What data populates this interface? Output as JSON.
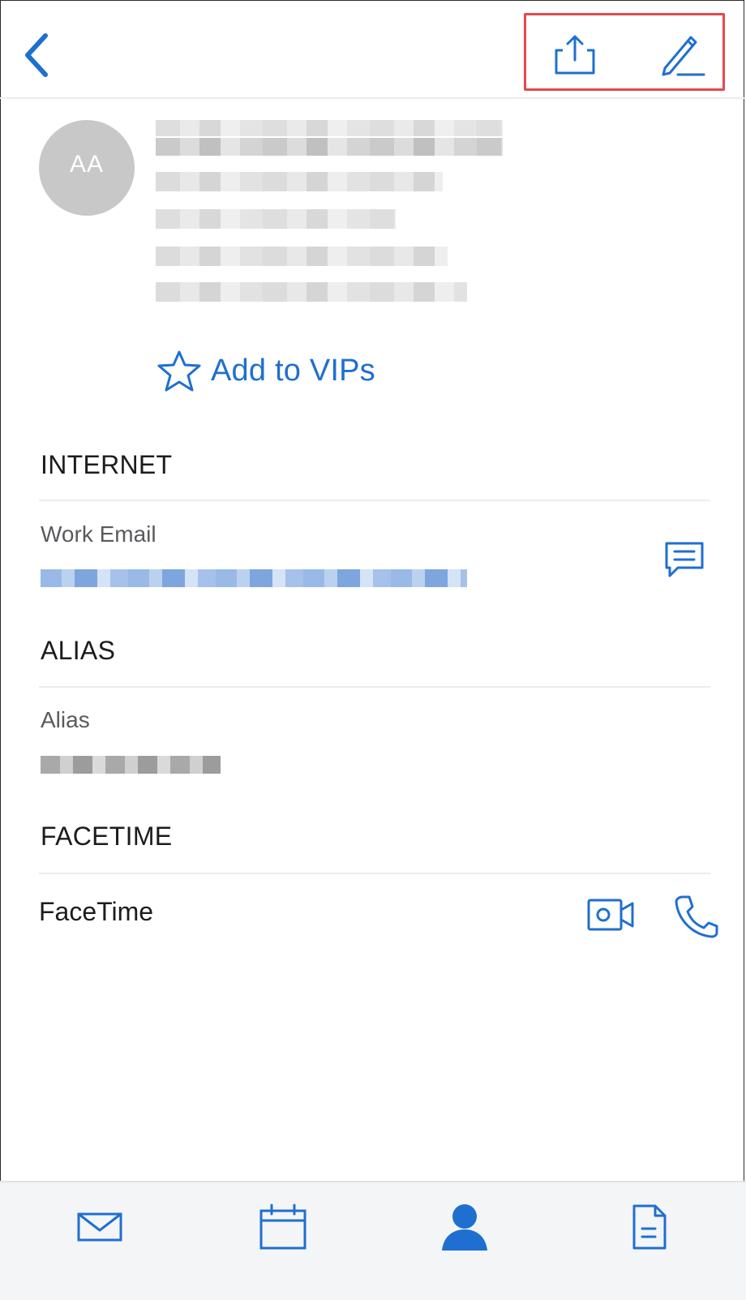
{
  "contact": {
    "initials": "AA"
  },
  "vip": {
    "label": "Add to VIPs"
  },
  "sections": {
    "internet_title": "INTERNET",
    "work_email_label": "Work Email",
    "alias_title": "ALIAS",
    "alias_label": "Alias",
    "facetime_title": "FACETIME",
    "facetime_label": "FaceTime"
  },
  "icons": {
    "back": "chevron-left-icon",
    "share": "share-icon",
    "edit": "pencil-icon",
    "star": "star-icon",
    "message": "message-icon",
    "video": "video-camera-icon",
    "phone": "phone-icon",
    "tabs": [
      "mail-icon",
      "calendar-icon",
      "person-icon",
      "document-icon"
    ]
  },
  "colors": {
    "accent": "#1f6fd0",
    "highlight_box": "#e5484d",
    "avatar_bg": "#c8c8c8"
  }
}
